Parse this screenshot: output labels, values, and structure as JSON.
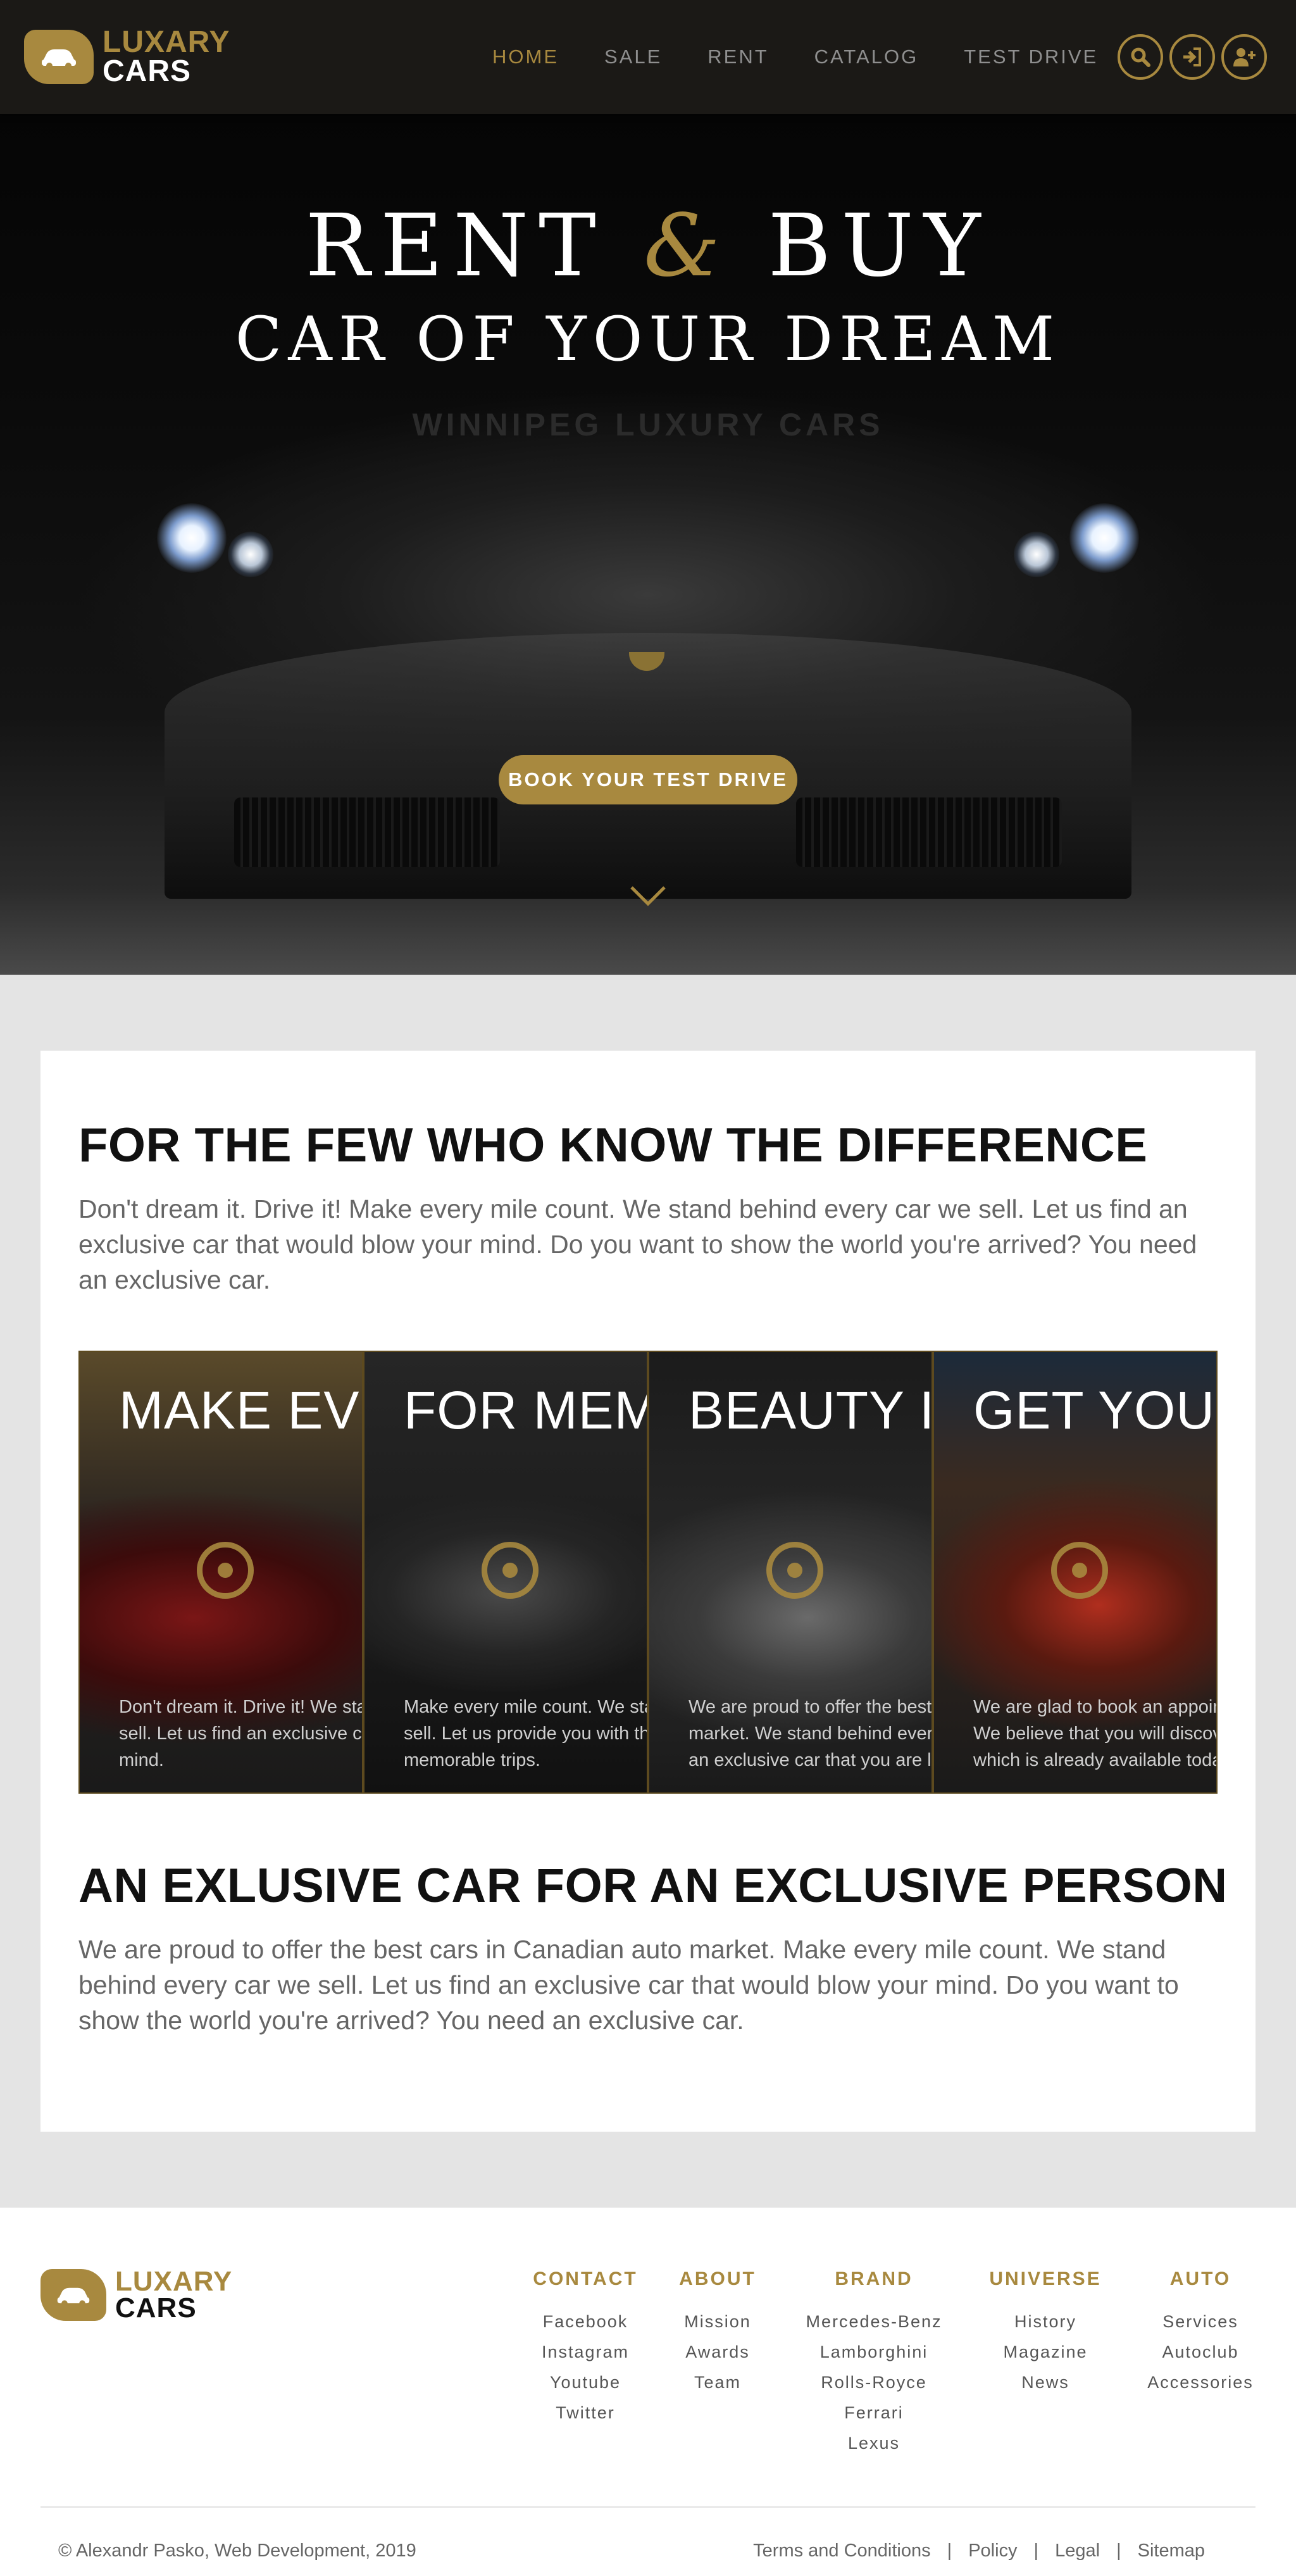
{
  "brand": {
    "line1": "LUXARY",
    "line2": "CARS",
    "accent": "#a8893f"
  },
  "nav": {
    "items": [
      "HOME",
      "SALE",
      "RENT",
      "CATALOG",
      "TEST DRIVE"
    ],
    "active": "HOME",
    "icons": [
      "search-icon",
      "login-icon",
      "add-user-icon"
    ]
  },
  "hero": {
    "title_rent": "RENT",
    "title_amp": "&",
    "title_buy": "BUY",
    "title_line2": "CAR OF YOUR DREAM",
    "subtitle": "WINNIPEG LUXURY CARS",
    "cta": "BOOK YOUR TEST DRIVE",
    "scroll_icon": "chevron-down-icon"
  },
  "section1": {
    "heading": "FOR THE FEW WHO KNOW THE DIFFERENCE",
    "text": "Don't dream it. Drive it! Make every mile count. We stand behind every car we sell. Let us find an exclusive car that would blow your mind. Do you want to show the world you're arrived? You need an exclusive car."
  },
  "panels": [
    {
      "title": "MAKE EVERY MILE COUNT",
      "line1": "Don't dream it. Drive it! We stand behind every car we",
      "line2": "sell. Let us find an exclusive car that would blow your",
      "line3": "mind."
    },
    {
      "title": "FOR MEMORABLE TRIPS",
      "line1": "Make every mile count. We stand behind every car we",
      "line2": "sell. Let us provide you with the best cars for",
      "line3": "memorable trips."
    },
    {
      "title": "BEAUTY IS IN DETAILS",
      "line1": "We are proud to offer the best cars in Canadian auto",
      "line2": "market. We stand behind every car we sell. Let us find",
      "line3": "an exclusive car that you are looking for."
    },
    {
      "title": "GET YOUR DREAM CAR",
      "line1": "We are glad to book an appointment for a test drive.",
      "line2": "We believe that you will discover the car of your dream",
      "line3": "which is already available today."
    }
  ],
  "section2": {
    "heading": "AN EXLUSIVE CAR FOR AN EXCLUSIVE PERSON",
    "text": "We are proud to offer the best cars in Canadian auto market. Make every mile count. We stand behind every car we sell. Let us find an exclusive car that would blow your mind. Do you want to show the world you're arrived? You need an exclusive car."
  },
  "footer": {
    "columns": [
      {
        "heading": "CONTACT",
        "items": [
          "Facebook",
          "Instagram",
          "Youtube",
          "Twitter"
        ]
      },
      {
        "heading": "ABOUT",
        "items": [
          "Mission",
          "Awards",
          "Team"
        ]
      },
      {
        "heading": "BRAND",
        "items": [
          "Mercedes-Benz",
          "Lamborghini",
          "Rolls-Royce",
          "Ferrari",
          "Lexus"
        ]
      },
      {
        "heading": "UNIVERSE",
        "items": [
          "History",
          "Magazine",
          "News"
        ]
      },
      {
        "heading": "AUTO",
        "items": [
          "Services",
          "Autoclub",
          "Accessories"
        ]
      }
    ],
    "copyright": "© Alexandr Pasko, Web Development, 2019",
    "links": [
      "Terms and Conditions",
      "Policy",
      "Legal",
      "Sitemap"
    ],
    "separator": "|"
  }
}
